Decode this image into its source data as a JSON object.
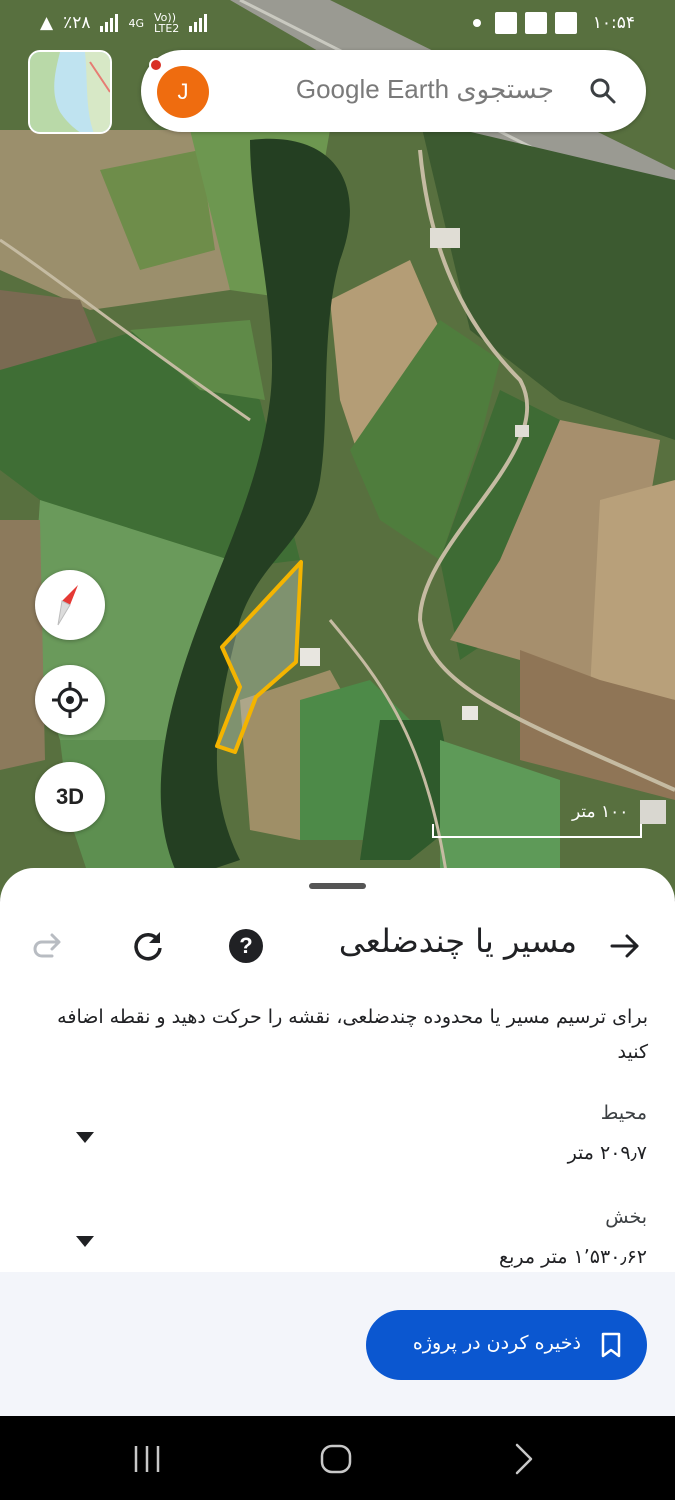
{
  "status_bar": {
    "battery": "٪۲۸",
    "network_4g": "4G",
    "network_volte": "Vo))",
    "network_lte": "LTE2",
    "time": "۱۰:۵۴"
  },
  "search": {
    "avatar_letter": "J",
    "placeholder": "جستجوی Google Earth"
  },
  "map_controls": {
    "three_d_label": "3D",
    "scale_label": "۱۰۰ متر"
  },
  "sheet": {
    "title": "مسیر یا چندضلعی",
    "instructions": "برای ترسیم مسیر یا محدوده چندضلعی، نقشه را حرکت دهید و نقطه اضافه کنید",
    "perimeter": {
      "label": "محیط",
      "value": "۲۰۹٫۷ متر"
    },
    "area": {
      "label": "بخش",
      "value": "۱٬۵۳۰٫۶۲ متر مربع"
    },
    "save_button": "ذخیره کردن در پروژه"
  },
  "colors": {
    "polygon_outline": "#f4b400",
    "save_button_bg": "#0b57d0",
    "avatar_bg": "#ef6c0f"
  },
  "icons": [
    "search-icon",
    "compass-icon",
    "my-location-icon",
    "arrow-forward-icon",
    "help-icon",
    "refresh-icon",
    "redo-icon",
    "chevron-down-icon",
    "bookmark-icon"
  ]
}
